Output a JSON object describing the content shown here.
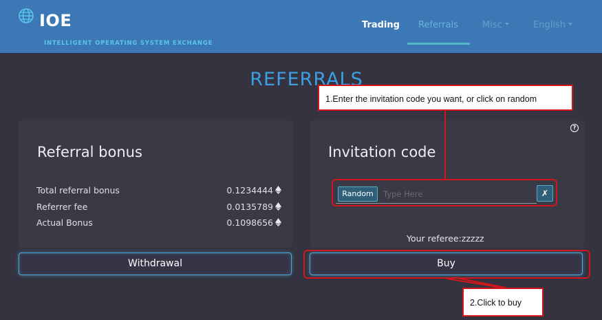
{
  "header": {
    "logo_icon": "globe-icon",
    "logo_text": "IOE",
    "logo_subtitle": "INTELLIGENT OPERATING SYSTEM EXCHANGE",
    "nav": [
      {
        "label": "Trading"
      },
      {
        "label": "Referrals",
        "active": true
      },
      {
        "label": "Misc"
      },
      {
        "label": "English"
      }
    ],
    "background_color": "#3b78b5"
  },
  "page": {
    "title": "REFERRALS",
    "title_color": "#3d9fe3"
  },
  "referral_bonus": {
    "title": "Referral bonus",
    "currency_icon": "eth-icon",
    "rows": [
      {
        "label": "Total referral bonus",
        "value": "0.1234444"
      },
      {
        "label": "Referrer fee",
        "value": "0.0135789"
      },
      {
        "label": "Actual Bonus",
        "value": "0.1098656"
      }
    ],
    "withdraw_label": "Withdrawal"
  },
  "invitation": {
    "title": "Invitation code",
    "help_icon": "question-circle-icon",
    "help_glyph": "?",
    "random_label": "Random",
    "input_value": "",
    "input_placeholder": "Type Here",
    "clear_label": "✗",
    "referee_text": "Your referee:zzzzz",
    "buy_label": "Buy"
  },
  "annotations": {
    "step1": "1.Enter the invitation code you want, or click on random",
    "step2": "2.Click to buy",
    "color": "#d4161c"
  }
}
